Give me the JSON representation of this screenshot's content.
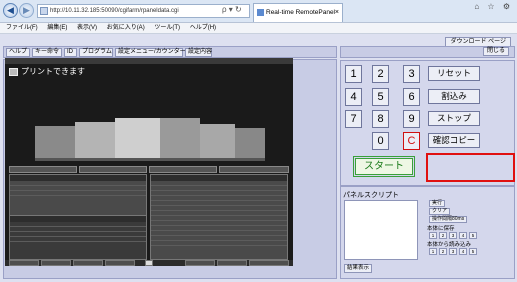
{
  "browser": {
    "address": "http://10.11.32.185:50090/cgifarm/rpaneldata.cgi",
    "address_tools": "ρ ▾ ↻",
    "tab_title": "Real-time RemotePanel",
    "tab_close": "×",
    "window_controls": "⌂ ☆ ⚙",
    "menu": [
      "ファイル(F)",
      "編集(E)",
      "表示(V)",
      "お気に入り(A)",
      "ツール(T)",
      "ヘルプ(H)"
    ]
  },
  "toolbar": {
    "download_label": "ダウンロード ページ",
    "help_label": "ヘルプ",
    "key_cmd_label": "キー命令",
    "id_label": "ID",
    "program_label": "プログラム",
    "settings_counter_label": "設定メニュー/カウンター",
    "settings_content_label": "設定内容",
    "close_label": "閉じる"
  },
  "screen": {
    "title": "プリントできます"
  },
  "keypad": {
    "digits": [
      "1",
      "2",
      "3",
      "4",
      "5",
      "6",
      "7",
      "8",
      "9",
      "0"
    ],
    "clear_label": "C",
    "reset_label": "リセット",
    "interrupt_label": "割込み",
    "stop_label": "ストップ",
    "proof_copy_label": "確認コピー",
    "start_label": "スタート"
  },
  "script": {
    "label": "パネルスクリプト",
    "result_label": "結果表示",
    "run_label": "実行",
    "clear_label": "クリア",
    "op_time_label": "操作間隔80ms",
    "save_label": "本体に保存",
    "load_label": "本体から読み込み",
    "slots": [
      "1",
      "2",
      "3",
      "4",
      "5"
    ]
  },
  "colors": {
    "clear_key": "#d01010",
    "start_button": "#1a7a1a",
    "highlight_box": "#e01010"
  }
}
